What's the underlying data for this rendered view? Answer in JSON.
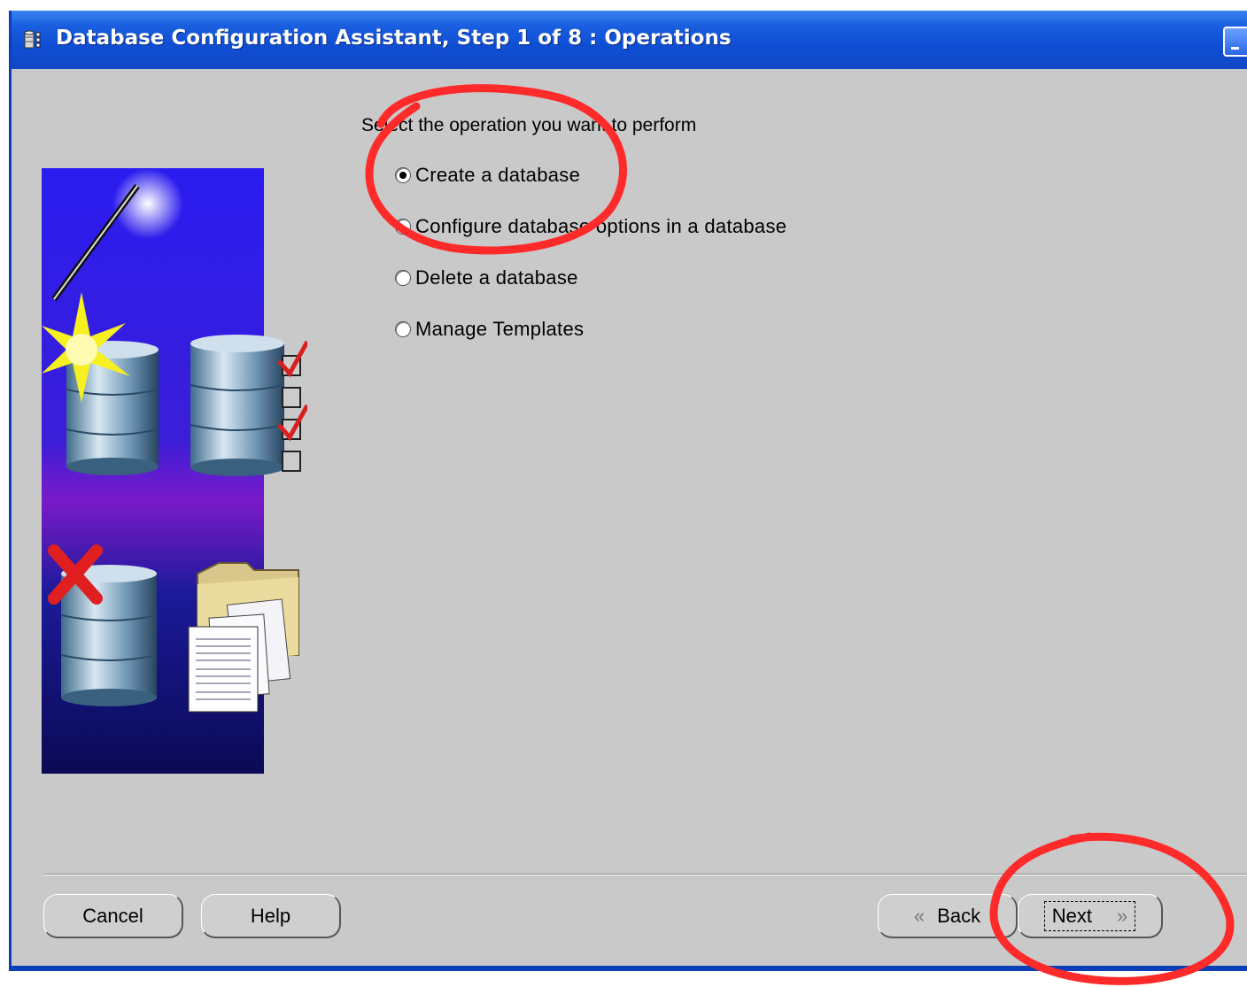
{
  "window": {
    "title": "Database Configuration Assistant, Step 1 of 8 : Operations",
    "title_bar_color": "#1250d4"
  },
  "main": {
    "prompt": "Select the operation you want to perform",
    "options": [
      {
        "label": "Create a database",
        "selected": true
      },
      {
        "label": "Configure database options in a database",
        "selected": false
      },
      {
        "label": "Delete a database",
        "selected": false
      },
      {
        "label": "Manage Templates",
        "selected": false
      }
    ]
  },
  "footer": {
    "cancel_label": "Cancel",
    "help_label": "Help",
    "back_label": "Back",
    "back_icon": "chevron-left-icon",
    "next_label": "Next",
    "next_icon": "chevron-right-icon"
  },
  "annotations": {
    "color": "#ff2a2a",
    "circled_items": [
      "Create a database",
      "Next"
    ]
  }
}
